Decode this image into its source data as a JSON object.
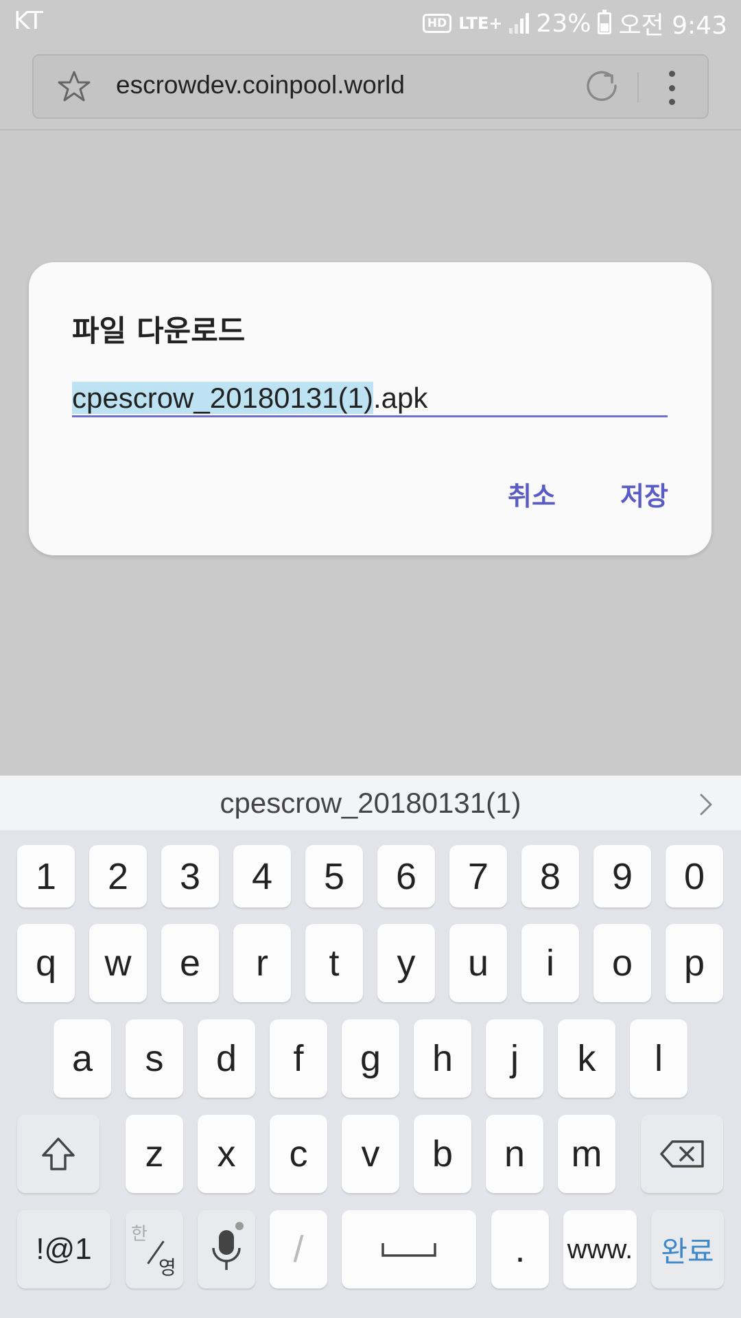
{
  "status_bar": {
    "carrier": "KT",
    "hd": "HD",
    "network": "LTE+",
    "battery": "23%",
    "time": "오전 9:43"
  },
  "browser": {
    "url": "escrowdev.coinpool.world"
  },
  "dialog": {
    "title": "파일 다운로드",
    "filename_selected": "cpescrow_20180131(1)",
    "filename_ext": ".apk",
    "cancel_label": "취소",
    "save_label": "저장",
    "accent_color": "#5b5bc5"
  },
  "keyboard": {
    "suggestion": "cpescrow_20180131(1)",
    "number_row": [
      "1",
      "2",
      "3",
      "4",
      "5",
      "6",
      "7",
      "8",
      "9",
      "0"
    ],
    "row1": [
      "q",
      "w",
      "e",
      "r",
      "t",
      "y",
      "u",
      "i",
      "o",
      "p"
    ],
    "row2": [
      "a",
      "s",
      "d",
      "f",
      "g",
      "h",
      "j",
      "k",
      "l"
    ],
    "row3": [
      "z",
      "x",
      "c",
      "v",
      "b",
      "n",
      "m"
    ],
    "symbols_label": "!@1",
    "lang_top": "한",
    "lang_bottom": "영",
    "slash_label": "/",
    "period_label": ".",
    "www_label": "www.",
    "done_label": "완료"
  }
}
